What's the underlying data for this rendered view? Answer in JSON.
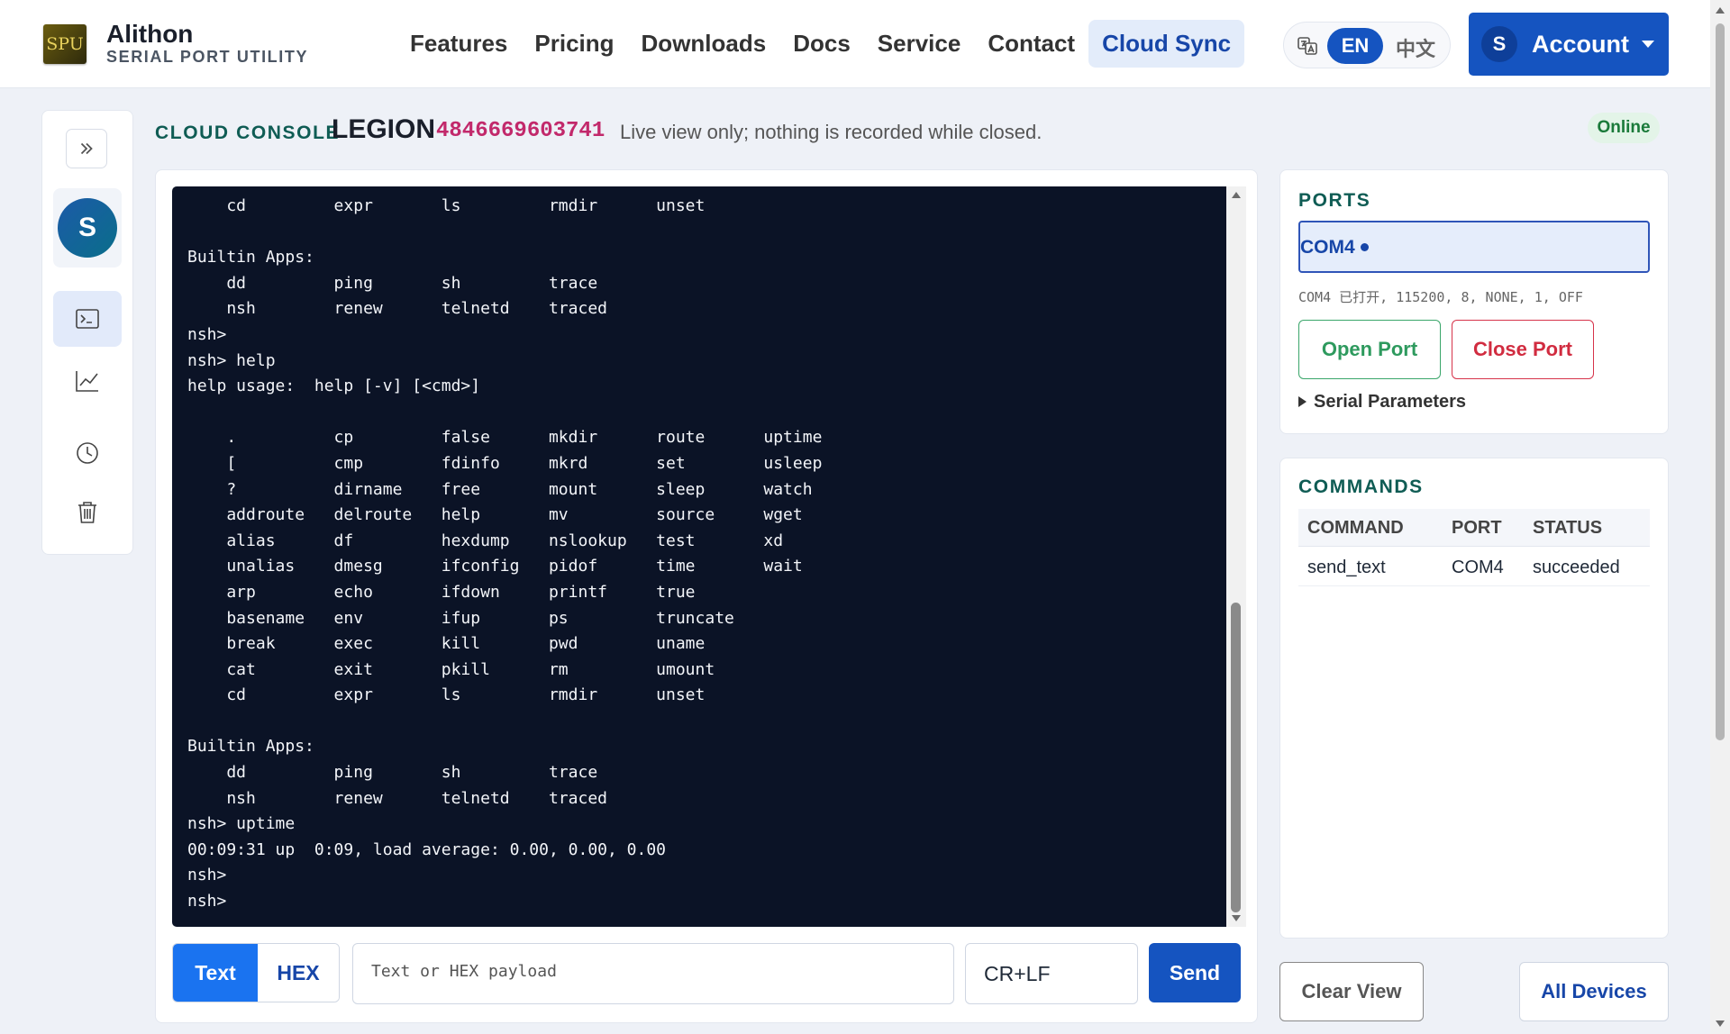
{
  "header": {
    "logo_text": "SPU",
    "brand_name": "Alithon",
    "brand_sub": "SERIAL PORT UTILITY",
    "nav": [
      "Features",
      "Pricing",
      "Downloads",
      "Docs",
      "Service",
      "Contact",
      "Cloud Sync"
    ],
    "active_nav": "Cloud Sync",
    "lang_en": "EN",
    "lang_zh": "中文",
    "account_initial": "S",
    "account_label": "Account"
  },
  "sidebar": {
    "avatar_initial": "S",
    "icons": [
      "expand-icon",
      "terminal-icon",
      "chart-icon",
      "history-icon",
      "trash-icon"
    ]
  },
  "console": {
    "label": "CLOUD CONSOLE",
    "device_name": "LEGION",
    "device_id": "4846669603741",
    "note": "Live view only; nothing is recorded while closed.",
    "status": "Online",
    "lines": [
      "    cd         expr       ls         rmdir      unset",
      "",
      "Builtin Apps:",
      "    dd         ping       sh         trace",
      "    nsh        renew      telnetd    traced",
      "nsh>",
      "nsh> help",
      "help usage:  help [-v] [<cmd>]",
      "",
      "    .          cp         false      mkdir      route      uptime",
      "    [          cmp        fdinfo     mkrd       set        usleep",
      "    ?          dirname    free       mount      sleep      watch",
      "    addroute   delroute   help       mv         source     wget",
      "    alias      df         hexdump    nslookup   test       xd",
      "    unalias    dmesg      ifconfig   pidof      time       wait",
      "    arp        echo       ifdown     printf     true",
      "    basename   env        ifup       ps         truncate",
      "    break      exec       kill       pwd        uname",
      "    cat        exit       pkill      rm         umount",
      "    cd         expr       ls         rmdir      unset",
      "",
      "Builtin Apps:",
      "    dd         ping       sh         trace",
      "    nsh        renew      telnetd    traced",
      "nsh> uptime",
      "00:09:31 up  0:09, load average: 0.00, 0.00, 0.00",
      "nsh>",
      "nsh>"
    ],
    "mode_text": "Text",
    "mode_hex": "HEX",
    "payload_placeholder": "Text or HEX payload",
    "line_ending": "CR+LF",
    "send_label": "Send"
  },
  "ports": {
    "title": "PORTS",
    "selected": "COM4",
    "status_line": "COM4 已打开, 115200, 8, NONE, 1, OFF",
    "open_label": "Open Port",
    "close_label": "Close Port",
    "params_label": "Serial Parameters"
  },
  "commands": {
    "title": "COMMANDS",
    "columns": [
      "COMMAND",
      "PORT",
      "STATUS"
    ],
    "rows": [
      {
        "command": "send_text",
        "port": "COM4",
        "status": "succeeded"
      }
    ]
  },
  "footer": {
    "clear_label": "Clear View",
    "all_devices_label": "All Devices"
  },
  "colors": {
    "primary": "#1554c0",
    "accent_teal": "#0f5c54",
    "device_id": "#c2296b",
    "terminal_bg": "#0b1326",
    "success": "#2e9a5e",
    "danger": "#d12c40"
  }
}
